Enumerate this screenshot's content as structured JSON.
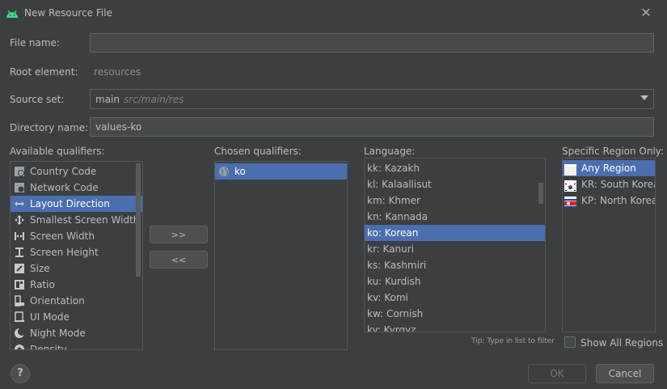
{
  "window": {
    "title": "New Resource File"
  },
  "form": {
    "file_name_label": "File name:",
    "file_name_value": "",
    "root_element_label": "Root element:",
    "root_element_value": "resources",
    "source_set_label": "Source set:",
    "source_set_value": "main",
    "source_set_path": "src/main/res",
    "directory_name_label": "Directory name:",
    "directory_name_value": "values-ko"
  },
  "available": {
    "label": "Available qualifiers:",
    "items": [
      {
        "label": "Country Code",
        "icon": "country-code-icon"
      },
      {
        "label": "Network Code",
        "icon": "network-code-icon"
      },
      {
        "label": "Layout Direction",
        "icon": "layout-direction-icon",
        "selected": true
      },
      {
        "label": "Smallest Screen Width",
        "icon": "smallest-width-icon"
      },
      {
        "label": "Screen Width",
        "icon": "screen-width-icon"
      },
      {
        "label": "Screen Height",
        "icon": "screen-height-icon"
      },
      {
        "label": "Size",
        "icon": "size-icon"
      },
      {
        "label": "Ratio",
        "icon": "ratio-icon"
      },
      {
        "label": "Orientation",
        "icon": "orientation-icon"
      },
      {
        "label": "UI Mode",
        "icon": "ui-mode-icon"
      },
      {
        "label": "Night Mode",
        "icon": "night-mode-icon"
      },
      {
        "label": "Density",
        "icon": "density-icon"
      }
    ]
  },
  "buttons": {
    "add": ">>",
    "remove": "<<",
    "ok": "OK",
    "cancel": "Cancel",
    "help": "?"
  },
  "chosen": {
    "label": "Chosen qualifiers:",
    "items": [
      {
        "label": "ko",
        "icon": "globe-icon"
      }
    ]
  },
  "language": {
    "label": "Language:",
    "items": [
      "kk: Kazakh",
      "kl: Kalaallisut",
      "km: Khmer",
      "kn: Kannada",
      "ko: Korean",
      "kr: Kanuri",
      "ks: Kashmiri",
      "ku: Kurdish",
      "kv: Komi",
      "kw: Cornish",
      "ky: Kyrgyz"
    ],
    "selected_index": 4,
    "tip": "Tip: Type in list to filter"
  },
  "region": {
    "label": "Specific Region Only:",
    "items": [
      {
        "label": "Any Region",
        "flag": "blank-flag-icon"
      },
      {
        "label": "KR: South Korea",
        "flag": "south-korea-flag-icon"
      },
      {
        "label": "KP: North Korea",
        "flag": "north-korea-flag-icon"
      }
    ],
    "selected_index": 0,
    "show_all_label": "Show All Regions",
    "show_all_checked": false
  },
  "colors": {
    "background": "#3c3f41",
    "selection": "#4b6eaf",
    "android_green": "#3ddc84"
  }
}
